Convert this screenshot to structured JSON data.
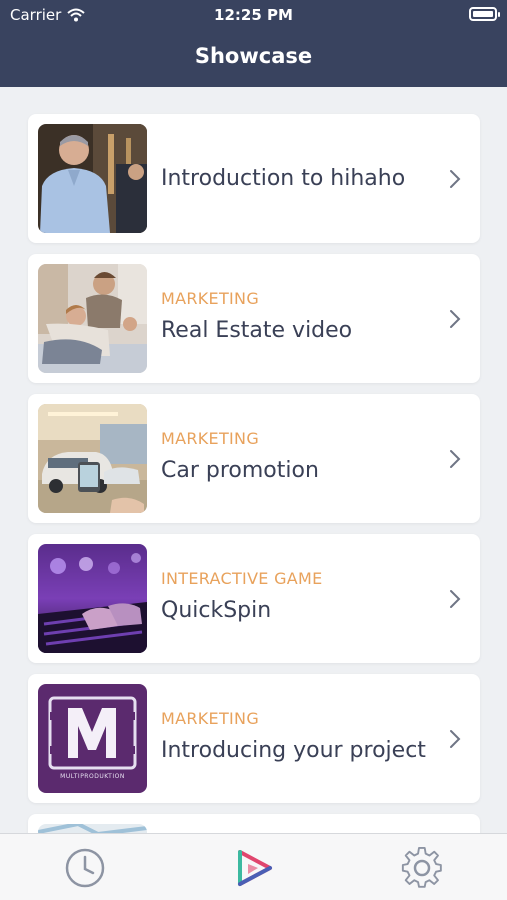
{
  "status_bar": {
    "carrier": "Carrier",
    "time": "12:25 PM"
  },
  "header": {
    "title": "Showcase"
  },
  "items": [
    {
      "category": "",
      "label": "Introduction to hihaho",
      "thumb": "presenter"
    },
    {
      "category": "MARKETING",
      "label": "Real Estate video",
      "thumb": "family"
    },
    {
      "category": "MARKETING",
      "label": "Car promotion",
      "thumb": "car-showroom"
    },
    {
      "category": "INTERACTIVE GAME",
      "label": "QuickSpin",
      "thumb": "gaming-keyboard"
    },
    {
      "category": "MARKETING",
      "label": "Introducing your project",
      "thumb": "multiproduktion-logo"
    }
  ],
  "logo_text": "MULTIPRODUKTION",
  "tabbar": {
    "icons": [
      "clock-icon",
      "hihaho-play-icon",
      "gear-icon"
    ]
  },
  "colors": {
    "header": "#39435f",
    "category": "#e8a25c",
    "label": "#3a4056",
    "background": "#eef0f3"
  }
}
